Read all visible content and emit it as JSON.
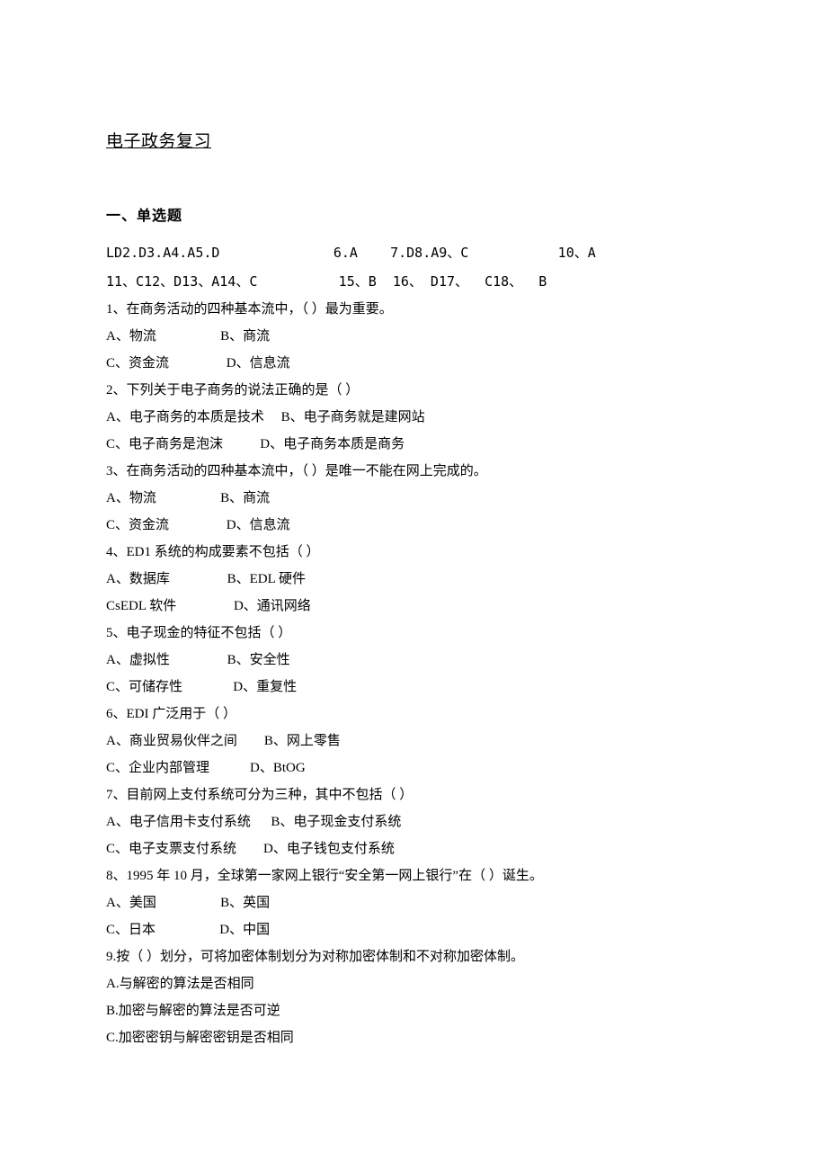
{
  "title": "电子政务复习",
  "section_header": "一、单选题",
  "answers_row1": "LD2.D3.A4.A5.D              6.A    7.D8.A9、C           10、A",
  "answers_row2": "11、C12、D13、A14、C          15、B  16、 D17、  C18、  B",
  "q1": {
    "text": "1、在商务活动的四种基本流中，（      ）最为重要。",
    "row1": "A、物流                   B、商流",
    "row2": "C、资金流                 D、信息流"
  },
  "q2": {
    "text": "2、下列关于电子商务的说法正确的是（      ）",
    "row1": "A、电子商务的本质是技术     B、电子商务就是建网站",
    "row2": "C、电子商务是泡沫           D、电子商务本质是商务"
  },
  "q3": {
    "text": "3、在商务活动的四种基本流中，（      ）是唯一不能在网上完成的。",
    "row1": "A、物流                   B、商流",
    "row2": "C、资金流                 D、信息流"
  },
  "q4": {
    "text": "4、ED1 系统的构成要素不包括（     ）",
    "row1": "A、数据库                 B、EDL 硬件",
    "row2": "CsEDL 软件                 D、通讯网络"
  },
  "q5": {
    "text": "5、电子现金的特征不包括（    ）",
    "row1": "A、虚拟性                 B、安全性",
    "row2": "C、可储存性               D、重复性"
  },
  "q6": {
    "text": "6、EDI 广泛用于（     ）",
    "row1": "A、商业贸易伙伴之间        B、网上零售",
    "row2": "C、企业内部管理            D、BtOG"
  },
  "q7": {
    "text": "7、目前网上支付系统可分为三种，其中不包括（      ）",
    "row1": "A、电子信用卡支付系统      B、电子现金支付系统",
    "row2": "C、电子支票支付系统        D、电子钱包支付系统"
  },
  "q8": {
    "text": "8、1995 年 10 月，全球第一家网上银行“安全第一网上银行”在（        ）诞生。",
    "row1": "A、美国                   B、英国",
    "row2": "C、日本                   D、中国"
  },
  "q9": {
    "text": "9.按（      ）划分，可将加密体制划分为对称加密体制和不对称加密体制。",
    "rowA": "A.与解密的算法是否相同",
    "rowB": "B.加密与解密的算法是否可逆",
    "rowC": "C.加密密钥与解密密钥是否相同"
  }
}
